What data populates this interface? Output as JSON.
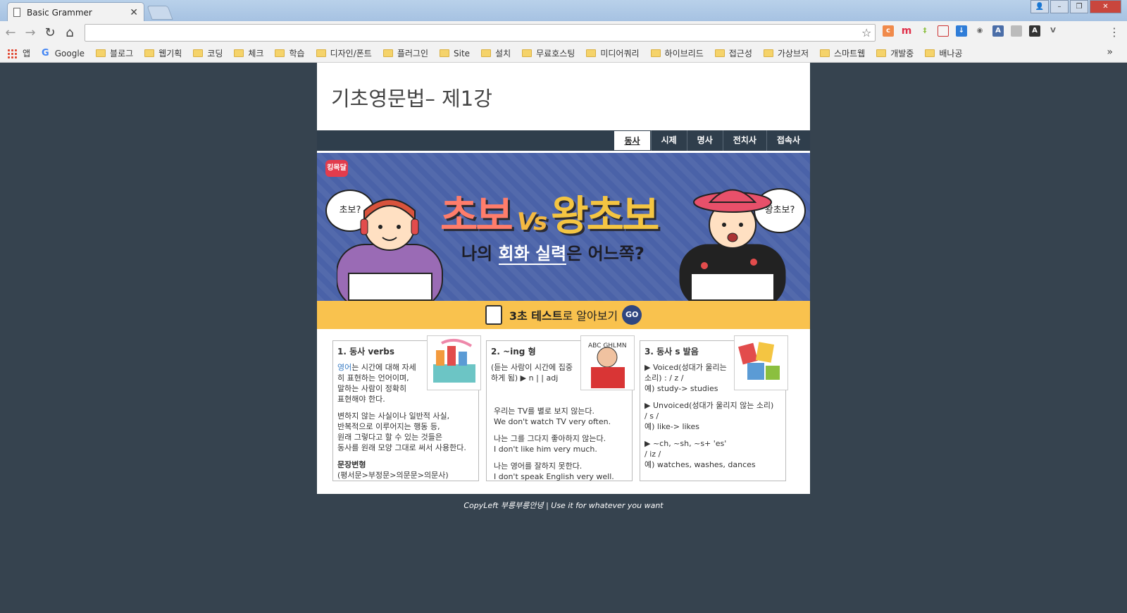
{
  "browser": {
    "tab_title": "Basic Grammer",
    "address_value": "",
    "bookmarks": [
      "앱",
      "Google",
      "블로그",
      "웹기획",
      "코딩",
      "체크",
      "학습",
      "디자인/폰트",
      "플러그인",
      "Site",
      "설치",
      "무료호스팅",
      "미디어쿼리",
      "하이브리드",
      "접근성",
      "가상브저",
      "스마트웹",
      "개발중",
      "배나공"
    ],
    "bookmarks_more": "»"
  },
  "page": {
    "title": "기초영문법– 제1강",
    "nav": [
      "동사",
      "시제",
      "명사",
      "전치사",
      "접속사"
    ],
    "banner": {
      "badge": "킹목달",
      "headline_left": "초보",
      "vs": "Vs",
      "headline_right": "왕초보",
      "sub_pre": "나의 ",
      "sub_hl": "회화 실력",
      "sub_post": "은 어느쪽?",
      "bubble_left": "초보?",
      "bubble_right": "왕초보?"
    },
    "cta": {
      "bold": "3초 테스트",
      "rest": "로 알아보기",
      "go": "GO"
    },
    "cards": [
      {
        "title": "1. 동사 verbs",
        "em": "영어",
        "lines": "는 시간에 대해 자세\n히 표현하는 언어이며,\n말하는 사람이 정확히\n표현해야 한다.",
        "para2": "변하지 않는 사실이나 일반적 사실,\n반복적으로 이루어지는 행동 등,\n원래 그렇다고 할 수 있는 것들은\n동사를 원래 모양 그대로 써서 사용한다.",
        "sub_title": "문장변형",
        "sub_text": "(평서문>부정문>의문문>의문사)"
      },
      {
        "title": "2. ~ing 형",
        "intro": "(듣는 사람이 시간에 집중\n하게 됨) ▶ n | | adj",
        "ex": [
          {
            "ko": "우리는 TV를 별로 보지 않는다.",
            "en": "We don't watch TV very often."
          },
          {
            "ko": "나는 그를 그다지 좋아하지 않는다.",
            "en": "I don't like him very much."
          },
          {
            "ko": "나는 영어를 잘하지 못한다.",
            "en": "I don't speak English very well."
          }
        ]
      },
      {
        "title": "3. 동사 s 발음",
        "v1": "▶ Voiced(성대가 울리는\n소리) : / z /",
        "v1_ex": "예) study-> studies",
        "v2": "▶ Unvoiced(성대가 울리지 않는 소리)\n/ s /",
        "v2_ex": "예) like-> likes",
        "v3": "▶ ~ch, ~sh, ~s+ 'es'\n/ iz /",
        "v3_ex": "예) watches, washes, dances"
      }
    ],
    "footer": "CopyLeft 부릉부릉안녕 | Use it for whatever you want"
  },
  "colors": {
    "page_bg": "#36434f",
    "nav_bg": "#2f3e4c",
    "banner_bg": "#4a62a8",
    "cta_bg": "#f9c24e",
    "accent_red": "#ff7d6b",
    "accent_gold": "#f4c542"
  }
}
